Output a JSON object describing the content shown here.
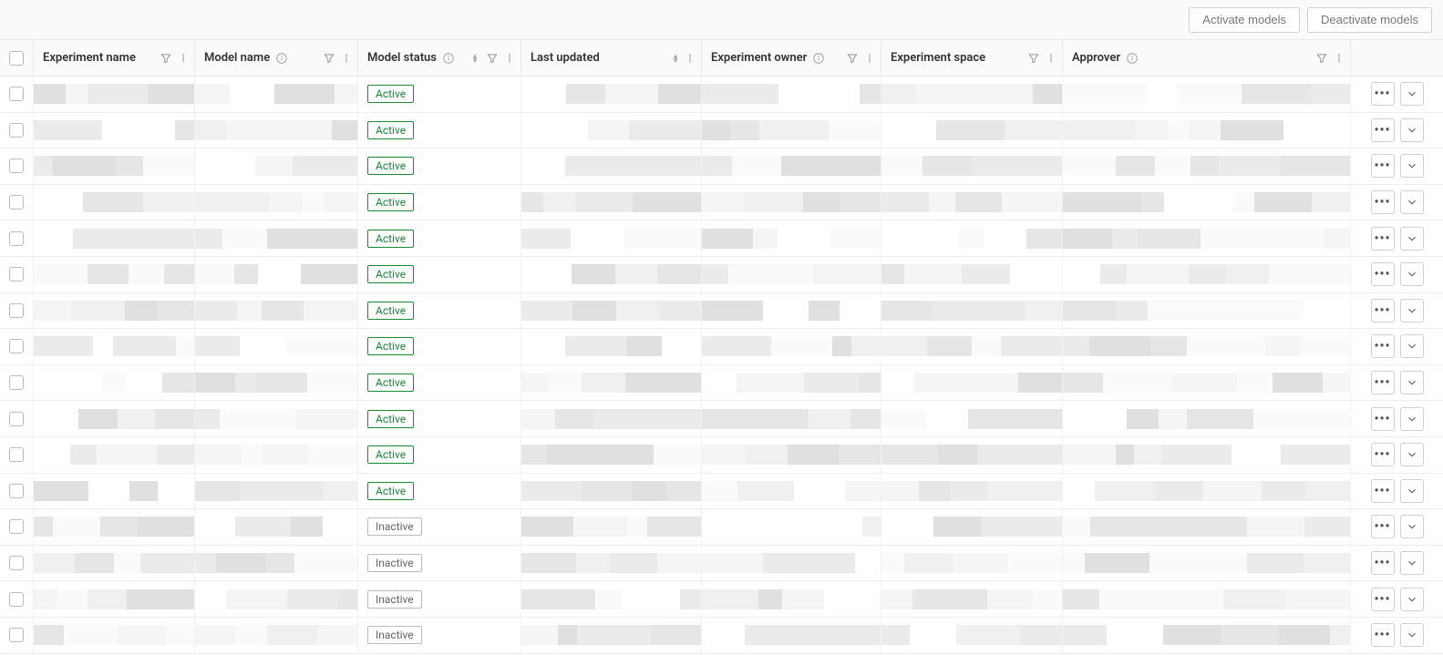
{
  "actions": {
    "activate": "Activate models",
    "deactivate": "Deactivate models"
  },
  "columns": {
    "experiment_name": "Experiment name",
    "model_name": "Model name",
    "model_status": "Model status",
    "last_updated": "Last updated",
    "experiment_owner": "Experiment owner",
    "experiment_space": "Experiment space",
    "approver": "Approver"
  },
  "status_labels": {
    "active": "Active",
    "inactive": "Inactive"
  },
  "rows": [
    {
      "status": "active"
    },
    {
      "status": "active"
    },
    {
      "status": "active"
    },
    {
      "status": "active"
    },
    {
      "status": "active"
    },
    {
      "status": "active"
    },
    {
      "status": "active"
    },
    {
      "status": "active"
    },
    {
      "status": "active"
    },
    {
      "status": "active"
    },
    {
      "status": "active"
    },
    {
      "status": "active"
    },
    {
      "status": "inactive"
    },
    {
      "status": "inactive"
    },
    {
      "status": "inactive"
    },
    {
      "status": "inactive"
    }
  ],
  "redaction_shades": [
    "#ffffff",
    "#fafafa",
    "#f5f5f5",
    "#f0f0f0",
    "#ebebeb",
    "#e6e6e6",
    "#e0e0e0"
  ]
}
